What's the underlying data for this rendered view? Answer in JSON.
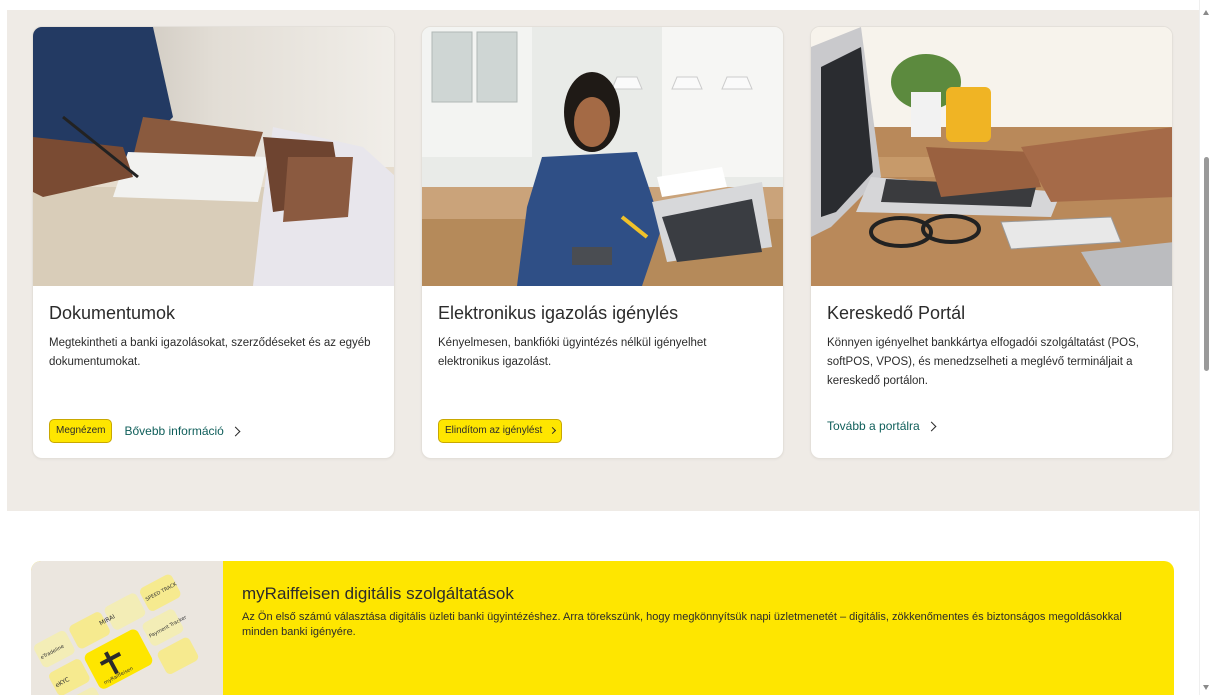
{
  "cards": [
    {
      "title": "Dokumentumok",
      "description": "Megtekintheti a banki igazolásokat, szerződéseket és az egyéb dokumentumokat.",
      "button_label": "Megnézem",
      "link_label": "Bővebb információ",
      "photo": "contract-signing-photo"
    },
    {
      "title": "Elektronikus igazolás igénylés",
      "description": "Kényelmesen, bankfióki ügyintézés nélkül igényelhet elektronikus igazolást.",
      "button_label": "Elindítom az igénylést",
      "photo": "woman-working-laptop-photo"
    },
    {
      "title": "Kereskedő Portál",
      "description": "Könnyen igényelhet bankkártya elfogadói szolgáltatást (POS, softPOS, VPOS), és menedzselheti a meglévő termináljait a kereskedő portálon.",
      "link_label": "Tovább a portálra",
      "photo": "typing-on-laptop-photo"
    }
  ],
  "promo": {
    "title": "myRaiffeisen digitális szolgáltatások",
    "text": "Az Ön első számú választása digitális üzleti banki ügyintézéshez. Arra törekszünk, hogy megkönnyítsük napi üzletmenetét – digitális, zökkenőmentes és biztonságos megoldásokkal minden banki igényére.",
    "image": "myraiffeisen-keyboard-illustration",
    "key_labels": [
      "MIRAI",
      "SPEED TRACK",
      "eKYC",
      "myRaiffeisen",
      "Payment Tracker",
      "eTradeline"
    ]
  },
  "colors": {
    "brand_yellow": "#fee600",
    "link_teal": "#0f5e5a",
    "band_beige": "#efebe6"
  }
}
